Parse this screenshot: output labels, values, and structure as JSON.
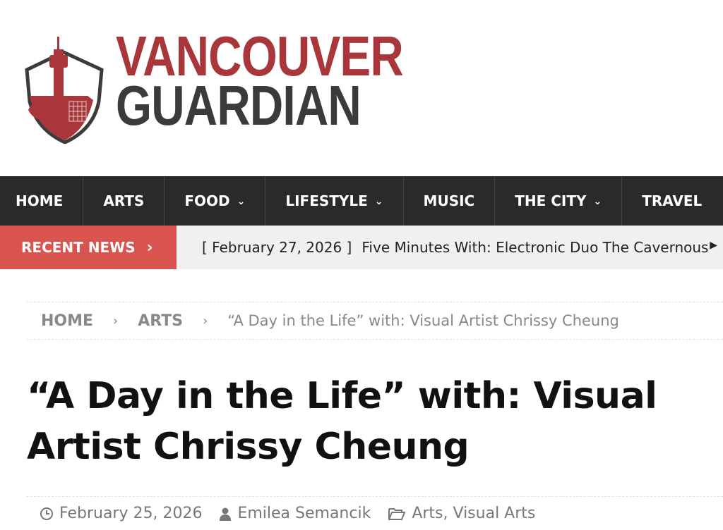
{
  "brand": {
    "name_line1": "VANCOUVER",
    "name_line2": "GUARDIAN",
    "color_primary": "#a8363a",
    "color_dark": "#3b3b3b"
  },
  "nav": {
    "items": [
      {
        "label": "HOME",
        "has_dropdown": false
      },
      {
        "label": "ARTS",
        "has_dropdown": false
      },
      {
        "label": "FOOD",
        "has_dropdown": true
      },
      {
        "label": "LIFESTYLE",
        "has_dropdown": true
      },
      {
        "label": "MUSIC",
        "has_dropdown": false
      },
      {
        "label": "THE CITY",
        "has_dropdown": true
      },
      {
        "label": "TRAVEL",
        "has_dropdown": false
      }
    ]
  },
  "ticker": {
    "label": "RECENT NEWS",
    "date": "[ February 27, 2026 ]",
    "title": "Five Minutes With: Electronic Duo The Cavernous",
    "accent": "#d9534f"
  },
  "breadcrumb": {
    "home": "HOME",
    "section": "ARTS",
    "current": "“A Day in the Life” with: Visual Artist Chrissy Cheung"
  },
  "article": {
    "title": "“A Day in the Life” with: Visual Artist Chrissy Cheung",
    "date": "February 25, 2026",
    "author": "Emilea Semancik",
    "categories": "Arts, Visual Arts"
  }
}
